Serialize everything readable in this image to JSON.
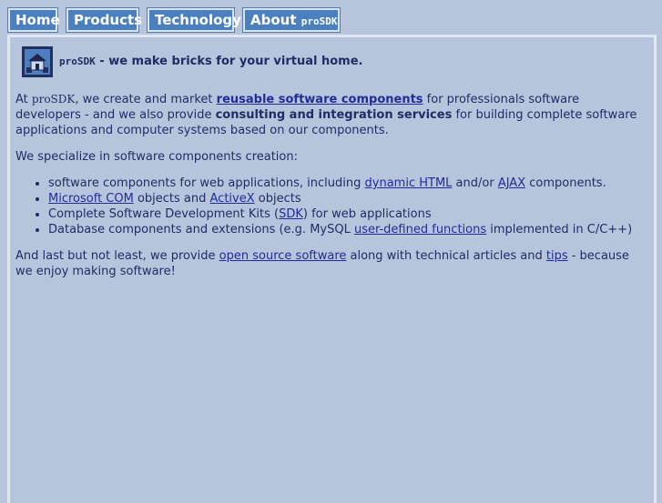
{
  "nav": {
    "tabs": [
      {
        "label": "Home"
      },
      {
        "label": "Products"
      },
      {
        "label": "Technology"
      },
      {
        "label": "About",
        "suffix": "proSDK"
      }
    ]
  },
  "header": {
    "brand": "proSDK",
    "tagline": " - we make bricks for your virtual home."
  },
  "intro": {
    "at": "At ",
    "brand": "proSDK",
    "t1": ", we create and market ",
    "link1": "reusable software components",
    "t2": " for professionals software developers - and we also provide ",
    "bold1": "consulting and integration services",
    "t3": " for building complete software applications and computer systems based on our components."
  },
  "specialize": {
    "heading": "We specialize in software components creation:",
    "items": [
      {
        "t1": "software components for web applications, including ",
        "link1": "dynamic HTML",
        "t2": " and/or ",
        "link2": "AJAX",
        "t3": " components."
      },
      {
        "link1": "Microsoft COM",
        "t1": " objects and ",
        "link2": "ActiveX",
        "t2": " objects"
      },
      {
        "t1": "Complete Software Development Kits (",
        "link1": "SDK",
        "t2": ") for web applications"
      },
      {
        "t1": "Database components and extensions (e.g. MySQL ",
        "link1": "user-defined functions",
        "t2": " implemented in C/C++)"
      }
    ]
  },
  "closing": {
    "t1": "And last but not least, we provide ",
    "link1": "open source software",
    "t2": " along with technical articles and ",
    "link2": "tips",
    "t3": " - because we enjoy making software!"
  }
}
